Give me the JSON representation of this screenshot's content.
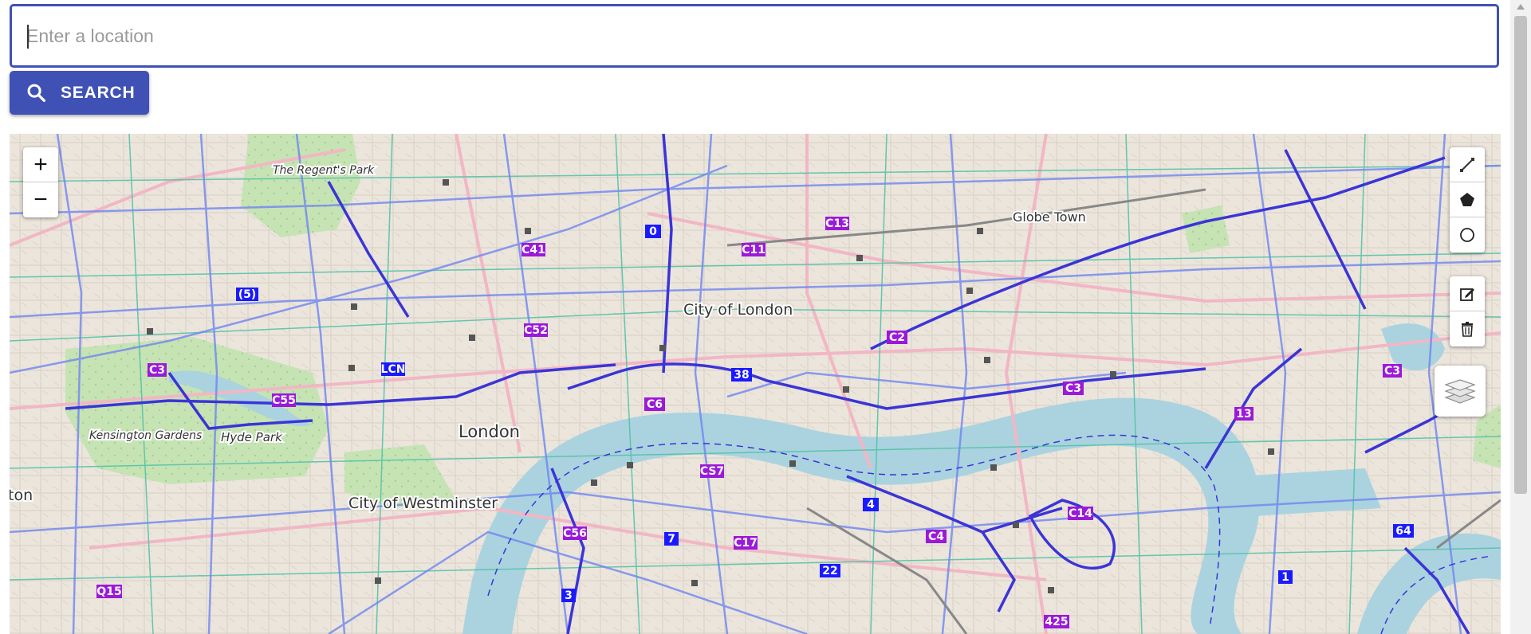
{
  "search": {
    "placeholder": "Enter a location",
    "value": "",
    "button_label": "SEARCH"
  },
  "map": {
    "zoom_in_label": "+",
    "zoom_out_label": "−",
    "draw_tools": [
      "polyline-icon",
      "polygon-icon",
      "circle-icon"
    ],
    "edit_tools": [
      "edit-icon",
      "delete-icon"
    ],
    "layers_icon": "layers-icon",
    "place_labels": [
      "City of London",
      "London",
      "City of Westminster",
      "Globe Town",
      "Hyde Park",
      "Kensington Gardens",
      "The Regent's Park"
    ],
    "cut_off_label": "ton",
    "route_labels": [
      "C41",
      "C11",
      "C13",
      "0",
      "(5)",
      "C52",
      "C3",
      "LCN",
      "C55",
      "38",
      "C6",
      "C2",
      "C3",
      "13",
      "C3",
      "CS7",
      "4",
      "C14",
      "C4",
      "C56",
      "7",
      "C17",
      "22",
      "3",
      "Q15",
      "64",
      "1",
      "425"
    ],
    "colors": {
      "water": "#aad3df",
      "park": "#b9d9a6",
      "route": "#4a49d8",
      "route_light": "#5c7cf0",
      "cycle": "#55c2a8",
      "badge_purple": "#9b19d8",
      "badge_blue": "#1a1aff"
    }
  }
}
